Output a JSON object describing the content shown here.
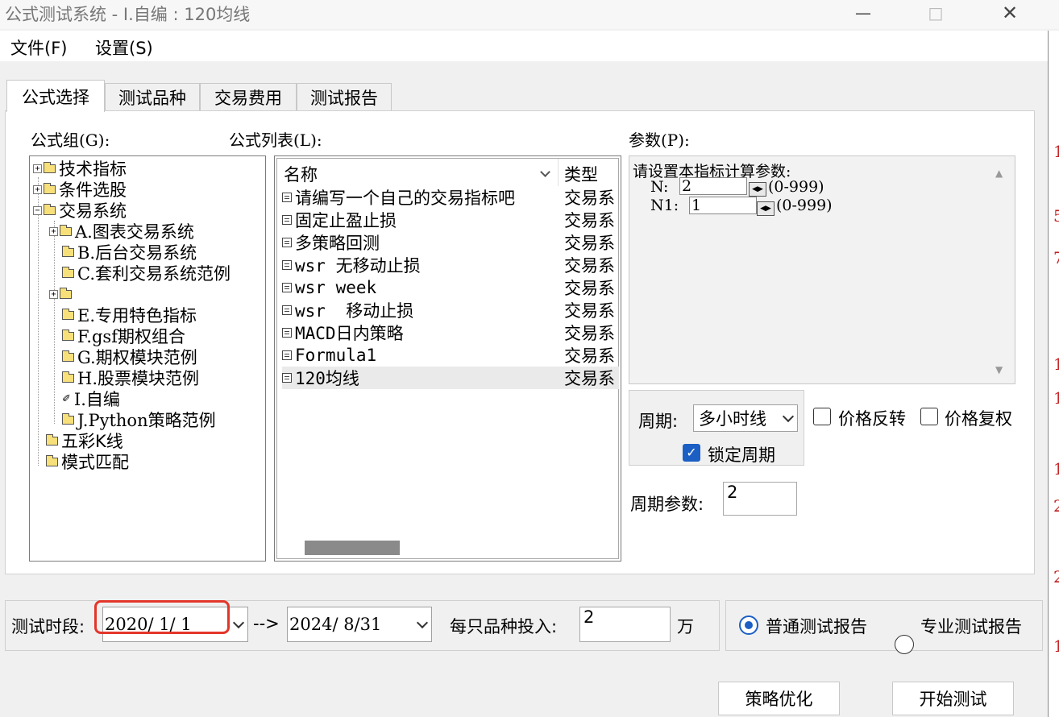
{
  "window": {
    "title": "公式测试系统 - I.自编 : 120均线",
    "min_glyph": "—",
    "max_glyph": "□",
    "close_glyph": "✕"
  },
  "menu": {
    "file": "文件(F)",
    "settings": "设置(S)"
  },
  "tabs": [
    "公式选择",
    "测试品种",
    "交易费用",
    "测试报告"
  ],
  "formula_group": {
    "label": "公式组(G):",
    "items": {
      "tech": "技术指标",
      "cond": "条件选股",
      "trade": "交易系统",
      "a": "A.图表交易系统",
      "b": "B.后台交易系统",
      "c": "C.套利交易系统范例",
      "d": "",
      "e": "E.专用特色指标",
      "f": "F.gsf期权组合",
      "g": "G.期权模块范例",
      "h": "H.股票模块范例",
      "i": "I.自编",
      "j": "J.Python策略范例",
      "five": "五彩K线",
      "pattern": "模式匹配"
    }
  },
  "formula_list": {
    "label": "公式列表(L):",
    "col_name": "名称",
    "col_type": "类型",
    "rows": [
      {
        "name": "请编写一个自己的交易指标吧",
        "type": "交易系"
      },
      {
        "name": "固定止盈止损",
        "type": "交易系"
      },
      {
        "name": "多策略回测",
        "type": "交易系"
      },
      {
        "name": "wsr 无移动止损",
        "type": "交易系"
      },
      {
        "name": "wsr week",
        "type": "交易系"
      },
      {
        "name": "wsr  移动止损",
        "type": "交易系"
      },
      {
        "name": "MACD日内策略",
        "type": "交易系"
      },
      {
        "name": "Formula1",
        "type": "交易系"
      },
      {
        "name": "120均线",
        "type": "交易系"
      }
    ]
  },
  "params": {
    "label": "参数(P):",
    "heading": "请设置本指标计算参数:",
    "n_label": "N:",
    "n_value": "2",
    "n_range": "(0-999)",
    "n1_label": "N1:",
    "n1_value": "1",
    "n1_range": "(0-999)"
  },
  "period": {
    "label": "周期:",
    "value": "多小时线",
    "lock_label": "锁定周期",
    "lock_checked": true,
    "param_label": "周期参数:",
    "param_value": "2"
  },
  "options": {
    "price_reverse": "价格反转",
    "price_adjust": "价格复权"
  },
  "test_period": {
    "label": "测试时段:",
    "start": "2020/ 1/ 1",
    "arrow": "-->",
    "end": "2024/ 8/31",
    "invest_label": "每只品种投入:",
    "invest_value": "2",
    "unit": "万"
  },
  "report": {
    "normal": "普通测试报告",
    "pro": "专业测试报告",
    "selected": "normal"
  },
  "buttons": {
    "optimize": "策略优化",
    "start": "开始测试"
  },
  "right_strip_digits": [
    "1",
    "5",
    "7",
    "1",
    "1",
    "1",
    "2",
    "2",
    "1"
  ],
  "colors": {
    "accent": "#1b5fc4",
    "highlight": "#e3362a"
  }
}
